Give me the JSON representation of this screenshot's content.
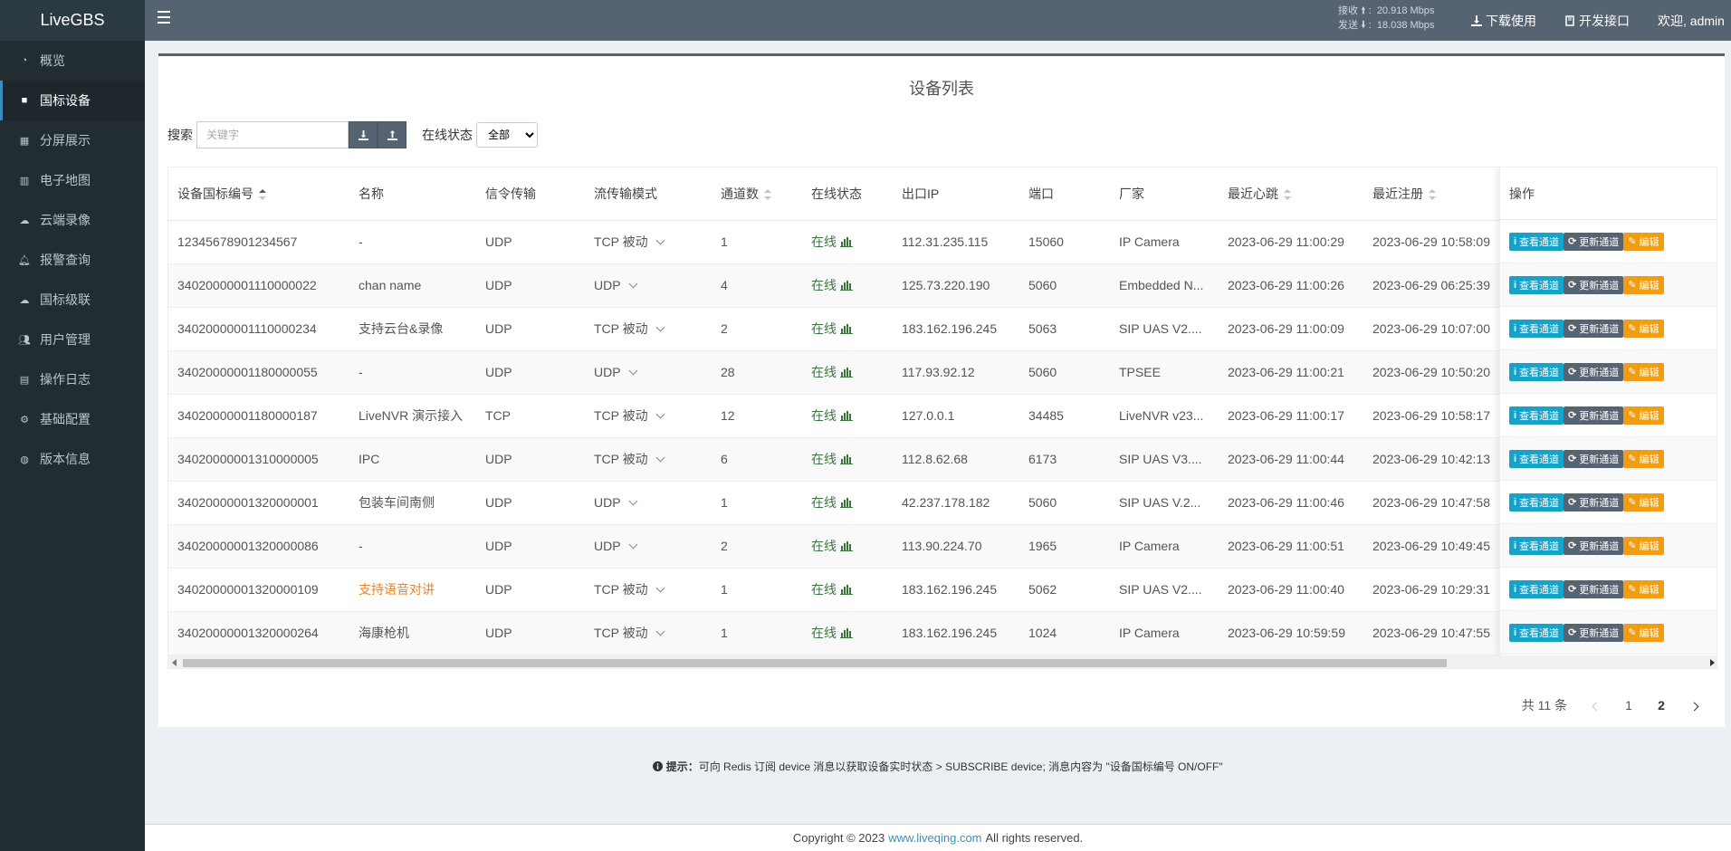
{
  "app": {
    "title": "LiveGBS",
    "net": {
      "recv_label": "接收",
      "recv_value": "20.918 Mbps",
      "send_label": "发送",
      "send_value": "18.038 Mbps"
    },
    "download_label": "下载使用",
    "api_label": "开发接口",
    "welcome": "欢迎, admin"
  },
  "sidebar": {
    "items": [
      {
        "label": "概览",
        "icon": "dashboard-icon"
      },
      {
        "label": "国标设备",
        "icon": "camera-icon",
        "active": true
      },
      {
        "label": "分屏展示",
        "icon": "grid-icon"
      },
      {
        "label": "电子地图",
        "icon": "map-icon"
      },
      {
        "label": "云端录像",
        "icon": "cloud-icon"
      },
      {
        "label": "报警查询",
        "icon": "bell-icon"
      },
      {
        "label": "国标级联",
        "icon": "cloud-upload-icon"
      },
      {
        "label": "用户管理",
        "icon": "users-icon"
      },
      {
        "label": "操作日志",
        "icon": "file-icon"
      },
      {
        "label": "基础配置",
        "icon": "cogs-icon"
      },
      {
        "label": "版本信息",
        "icon": "globe-icon"
      }
    ]
  },
  "page": {
    "title": "设备列表",
    "search_label": "搜索",
    "search_placeholder": "关键字",
    "status_label": "在线状态",
    "status_value": "全部"
  },
  "table": {
    "columns": [
      "设备国标编号",
      "名称",
      "信令传输",
      "流传输模式",
      "通道数",
      "在线状态",
      "出口IP",
      "端口",
      "厂家",
      "最近心跳",
      "最近注册"
    ],
    "op_header": "操作",
    "op_buttons": {
      "view": "查看通道",
      "update": "更新通道",
      "edit": "编辑"
    },
    "rows": [
      {
        "id": "12345678901234567",
        "name": "-",
        "signal": "UDP",
        "stream": "TCP 被动",
        "channels": "1",
        "status": "在线",
        "ip": "112.31.235.115",
        "port": "15060",
        "vendor": "IP Camera",
        "heartbeat": "2023-06-29 11:00:29",
        "register": "2023-06-29 10:58:09"
      },
      {
        "id": "34020000001110000022",
        "name": "chan name",
        "signal": "UDP",
        "stream": "UDP",
        "channels": "4",
        "status": "在线",
        "ip": "125.73.220.190",
        "port": "5060",
        "vendor": "Embedded N...",
        "heartbeat": "2023-06-29 11:00:26",
        "register": "2023-06-29 06:25:39"
      },
      {
        "id": "34020000001110000234",
        "name": "支持云台&录像",
        "signal": "UDP",
        "stream": "TCP 被动",
        "channels": "2",
        "status": "在线",
        "ip": "183.162.196.245",
        "port": "5063",
        "vendor": "SIP UAS V2....",
        "heartbeat": "2023-06-29 11:00:09",
        "register": "2023-06-29 10:07:00"
      },
      {
        "id": "34020000001180000055",
        "name": "-",
        "signal": "UDP",
        "stream": "UDP",
        "channels": "28",
        "status": "在线",
        "ip": "117.93.92.12",
        "port": "5060",
        "vendor": "TPSEE",
        "heartbeat": "2023-06-29 11:00:21",
        "register": "2023-06-29 10:50:20"
      },
      {
        "id": "34020000001180000187",
        "name": "LiveNVR 演示接入",
        "signal": "TCP",
        "stream": "TCP 被动",
        "channels": "12",
        "status": "在线",
        "ip": "127.0.0.1",
        "port": "34485",
        "vendor": "LiveNVR v23...",
        "heartbeat": "2023-06-29 11:00:17",
        "register": "2023-06-29 10:58:17"
      },
      {
        "id": "34020000001310000005",
        "name": "IPC",
        "signal": "UDP",
        "stream": "TCP 被动",
        "channels": "6",
        "status": "在线",
        "ip": "112.8.62.68",
        "port": "6173",
        "vendor": "SIP UAS V3....",
        "heartbeat": "2023-06-29 11:00:44",
        "register": "2023-06-29 10:42:13"
      },
      {
        "id": "34020000001320000001",
        "name": "包装车间南侧",
        "signal": "UDP",
        "stream": "UDP",
        "channels": "1",
        "status": "在线",
        "ip": "42.237.178.182",
        "port": "5060",
        "vendor": "SIP UAS V.2...",
        "heartbeat": "2023-06-29 11:00:46",
        "register": "2023-06-29 10:47:58"
      },
      {
        "id": "34020000001320000086",
        "name": "-",
        "signal": "UDP",
        "stream": "UDP",
        "channels": "2",
        "status": "在线",
        "ip": "113.90.224.70",
        "port": "1965",
        "vendor": "IP Camera",
        "heartbeat": "2023-06-29 11:00:51",
        "register": "2023-06-29 10:49:45"
      },
      {
        "id": "34020000001320000109",
        "name": "支持语音对讲",
        "name_highlight": true,
        "signal": "UDP",
        "stream": "TCP 被动",
        "channels": "1",
        "status": "在线",
        "ip": "183.162.196.245",
        "port": "5062",
        "vendor": "SIP UAS V2....",
        "heartbeat": "2023-06-29 11:00:40",
        "register": "2023-06-29 10:29:31"
      },
      {
        "id": "34020000001320000264",
        "name": "海康枪机",
        "signal": "UDP",
        "stream": "TCP 被动",
        "channels": "1",
        "status": "在线",
        "ip": "183.162.196.245",
        "port": "1024",
        "vendor": "IP Camera",
        "heartbeat": "2023-06-29 10:59:59",
        "register": "2023-06-29 10:47:55"
      }
    ]
  },
  "pagination": {
    "total": "共 11 条",
    "pages": [
      "1",
      "2"
    ],
    "current": "2"
  },
  "tip": {
    "prefix": "提示：",
    "text": "可向 Redis 订阅 device 消息以获取设备实时状态 > SUBSCRIBE device; 消息内容为 \"设备国标编号 ON/OFF\""
  },
  "footer": {
    "copyright": "Copyright © 2023",
    "link": "www.liveqing.com",
    "rights": "All rights reserved."
  },
  "colors": {
    "header": "#566472",
    "sidebar": "#222d32",
    "online": "#3c763d",
    "view_btn": "#17a2c9",
    "edit_btn": "#f39c12",
    "link": "#3c8dbc"
  }
}
